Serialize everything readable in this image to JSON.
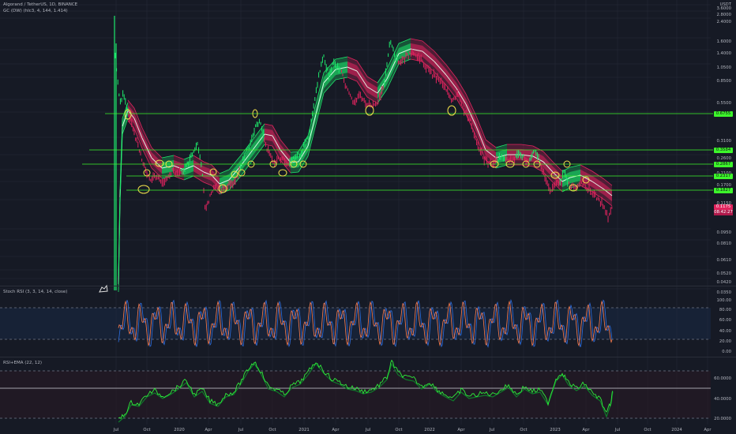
{
  "header": {
    "symbol": "Algorand / TetherUS, 1D, BINANCE",
    "indicator": "GC (DW) (hlc3, 4, 144, 1.414)"
  },
  "price_axis": {
    "currency": "USDT",
    "ticks": [
      "3.6000",
      "2.8000",
      "2.4000",
      "1.6000",
      "1.4000",
      "1.0500",
      "0.8500",
      "0.5500",
      "0.4500",
      "0.3100",
      "0.2600",
      "0.2100",
      "0.1700",
      "0.1150",
      "0.0950",
      "0.0810",
      "0.0610",
      "0.0520",
      "0.0420",
      "0.0350"
    ],
    "level_tags": [
      "0.6755",
      "0.3584",
      "0.2867",
      "0.2317",
      "0.1827"
    ],
    "current_price": "0.1175",
    "countdown": "08:42:27"
  },
  "stoch_rsi": {
    "label": "Stoch RSI (3, 3, 14, 14, close)",
    "ticks": [
      "100.00",
      "80.00",
      "60.00",
      "40.00",
      "20.00",
      "0.00"
    ]
  },
  "rsi_ema": {
    "label": "RSI+EMA (22, 12)",
    "ticks": [
      "60.0000",
      "40.0000",
      "20.0000"
    ]
  },
  "time_axis": [
    "Jul",
    "Oct",
    "2020",
    "Apr",
    "Jul",
    "Oct",
    "2021",
    "Apr",
    "Jul",
    "Oct",
    "2022",
    "Apr",
    "Jul",
    "Oct",
    "2023",
    "Apr",
    "Jul",
    "Oct",
    "2024",
    "Apr"
  ],
  "colors": {
    "background": "#161a25",
    "up": "#1ee96c",
    "down": "#e0245e",
    "level_line": "#3df52b",
    "annotation": "#f3e24b",
    "stoch_k": "#2e6fe0",
    "stoch_d": "#ff7f50",
    "rsi_line": "#2eea3a"
  },
  "icons": {
    "watermark": "tradingview-cursor-icon"
  }
}
